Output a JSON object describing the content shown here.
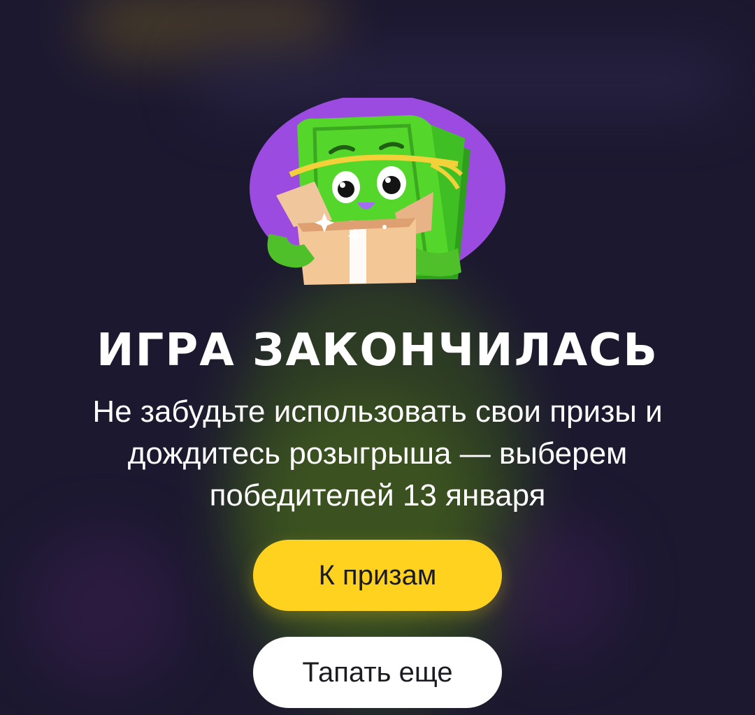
{
  "game_over": {
    "title": "ИГРА ЗАКОНЧИЛАСЬ",
    "subtitle": "Не забудьте использовать свои призы и дождитесь розыгрыша — выберем победителей 13 января",
    "mascot": "money-stack-mascot-with-gift-box"
  },
  "actions": {
    "to_prizes_label": "К призам",
    "tap_more_label": "Тапать еще"
  },
  "colors": {
    "background": "#1c1830",
    "mascot_circle": "#9b4be0",
    "mascot_green": "#55d62a",
    "primary_button": "#ffd21f",
    "secondary_button": "#ffffff",
    "text": "#ffffff"
  }
}
